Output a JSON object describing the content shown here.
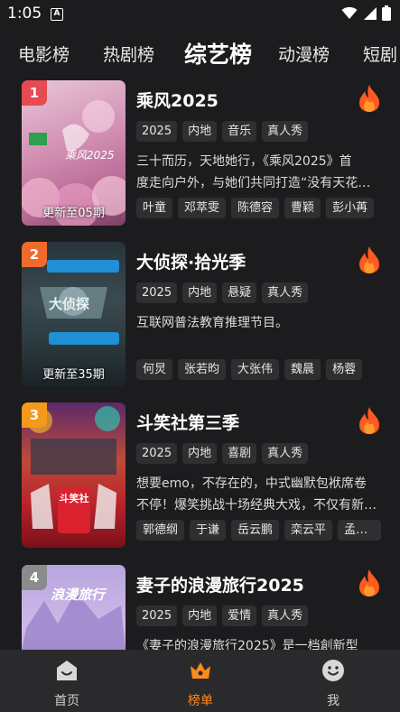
{
  "status": {
    "time": "1:05",
    "notif_letter": "A"
  },
  "tabs": [
    {
      "label": "电影榜"
    },
    {
      "label": "热剧榜"
    },
    {
      "label": "综艺榜"
    },
    {
      "label": "动漫榜"
    },
    {
      "label": "短剧"
    }
  ],
  "active_tab": "综艺榜",
  "items": [
    {
      "rank": "1",
      "rank_color": "#e64a52",
      "title": "乘风2025",
      "update": "更新至05期",
      "tags": [
        "2025",
        "内地",
        "音乐",
        "真人秀"
      ],
      "desc": [
        "三十而历，天地她行，《乘风2025》首",
        "度走向户外，与她们共同打造“没有天花板的舞台”"
      ],
      "people": [
        "叶童",
        "邓萃雯",
        "陈德容",
        "曹颖",
        "彭小苒"
      ],
      "poster_label": "乘风2025"
    },
    {
      "rank": "2",
      "rank_color": "#f06a2c",
      "title": "大侦探·拾光季",
      "update": "更新至35期",
      "tags": [
        "2025",
        "内地",
        "悬疑",
        "真人秀"
      ],
      "desc": [
        "互联网普法教育推理节目。"
      ],
      "people": [
        "何炅",
        "张若昀",
        "大张伟",
        "魏晨",
        "杨蓉"
      ],
      "poster_label": "大侦探"
    },
    {
      "rank": "3",
      "rank_color": "#f29a1a",
      "title": "斗笑社第三季",
      "update": "",
      "tags": [
        "2025",
        "内地",
        "喜剧",
        "真人秀"
      ],
      "desc": [
        "想要emo，不存在的，中式幽默包袱席卷",
        "不停！爆笑挑战十场经典大戏，不仅有新作品还有新玩法"
      ],
      "people": [
        "郭德纲",
        "于谦",
        "岳云鹏",
        "栾云平",
        "孟鹤堂"
      ],
      "poster_label": "斗笑社"
    },
    {
      "rank": "4",
      "rank_color": "#8b8b8e",
      "title": "妻子的浪漫旅行2025",
      "update": "",
      "tags": [
        "2025",
        "内地",
        "爱情",
        "真人秀"
      ],
      "desc": [
        "《妻子的浪漫旅行2025》是一档創新型"
      ],
      "people": [],
      "poster_label": "浪漫旅行"
    }
  ],
  "bottom_nav": [
    {
      "label": "首页",
      "icon": "home-icon"
    },
    {
      "label": "榜单",
      "icon": "crown-icon"
    },
    {
      "label": "我",
      "icon": "profile-icon"
    }
  ],
  "colors": {
    "accent": "#ff8a1c",
    "background": "#1c1c1e",
    "tag_bg": "#2f2f31",
    "flame": "#ff5a1f"
  }
}
